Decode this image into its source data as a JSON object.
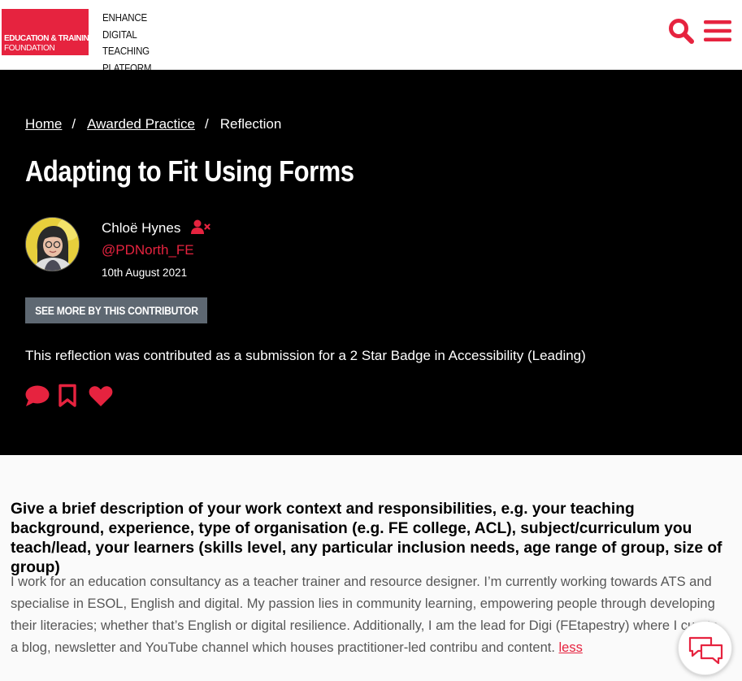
{
  "header": {
    "logo_line1": "EDUCATION & TRAINING",
    "logo_line2": "FOUNDATION",
    "platform_line1": "Enhance",
    "platform_line2": "Digital Teaching",
    "platform_line3": "Platform",
    "search_icon": "search-icon",
    "menu_icon": "hamburger-menu-icon"
  },
  "breadcrumb": {
    "home": "Home",
    "section": "Awarded Practice",
    "current": "Reflection",
    "separator": "/"
  },
  "article": {
    "title": "Adapting to Fit Using Forms",
    "author_name": "Chloë Hynes",
    "author_handle": "@PDNorth_FE",
    "date": "10th August 2021",
    "contributor_button": "See more by this contributor",
    "submission_note": "This reflection was contributed as a submission for a 2 Star Badge in Accessibility (Leading)",
    "actions": [
      "comment-icon",
      "bookmark-icon",
      "heart-icon"
    ]
  },
  "content": {
    "question": "Give a brief description of your work context and responsibilities, e.g. your teaching background, experience, type of organisation (e.g. FE college, ACL), subject/curriculum you teach/lead, your learners (skills level, any particular inclusion needs, age range of group, size of group)",
    "answer": "I work for an education consultancy as a teacher trainer and resource designer. I’m currently working towards ATS and specialise in ESOL, English and digital. My passion lies in community learning, empowering people through developing their literacies; whether that’s English or digital resilience. Additionally, I am the lead for Digi (FEtapestry) where I curate a blog, newsletter and YouTube channel which houses practitioner-led contribu and content.",
    "less_link": "less"
  },
  "colors": {
    "brand_red": "#e6233f",
    "hero_bg": "#000000",
    "button_grey": "#5e6872"
  }
}
